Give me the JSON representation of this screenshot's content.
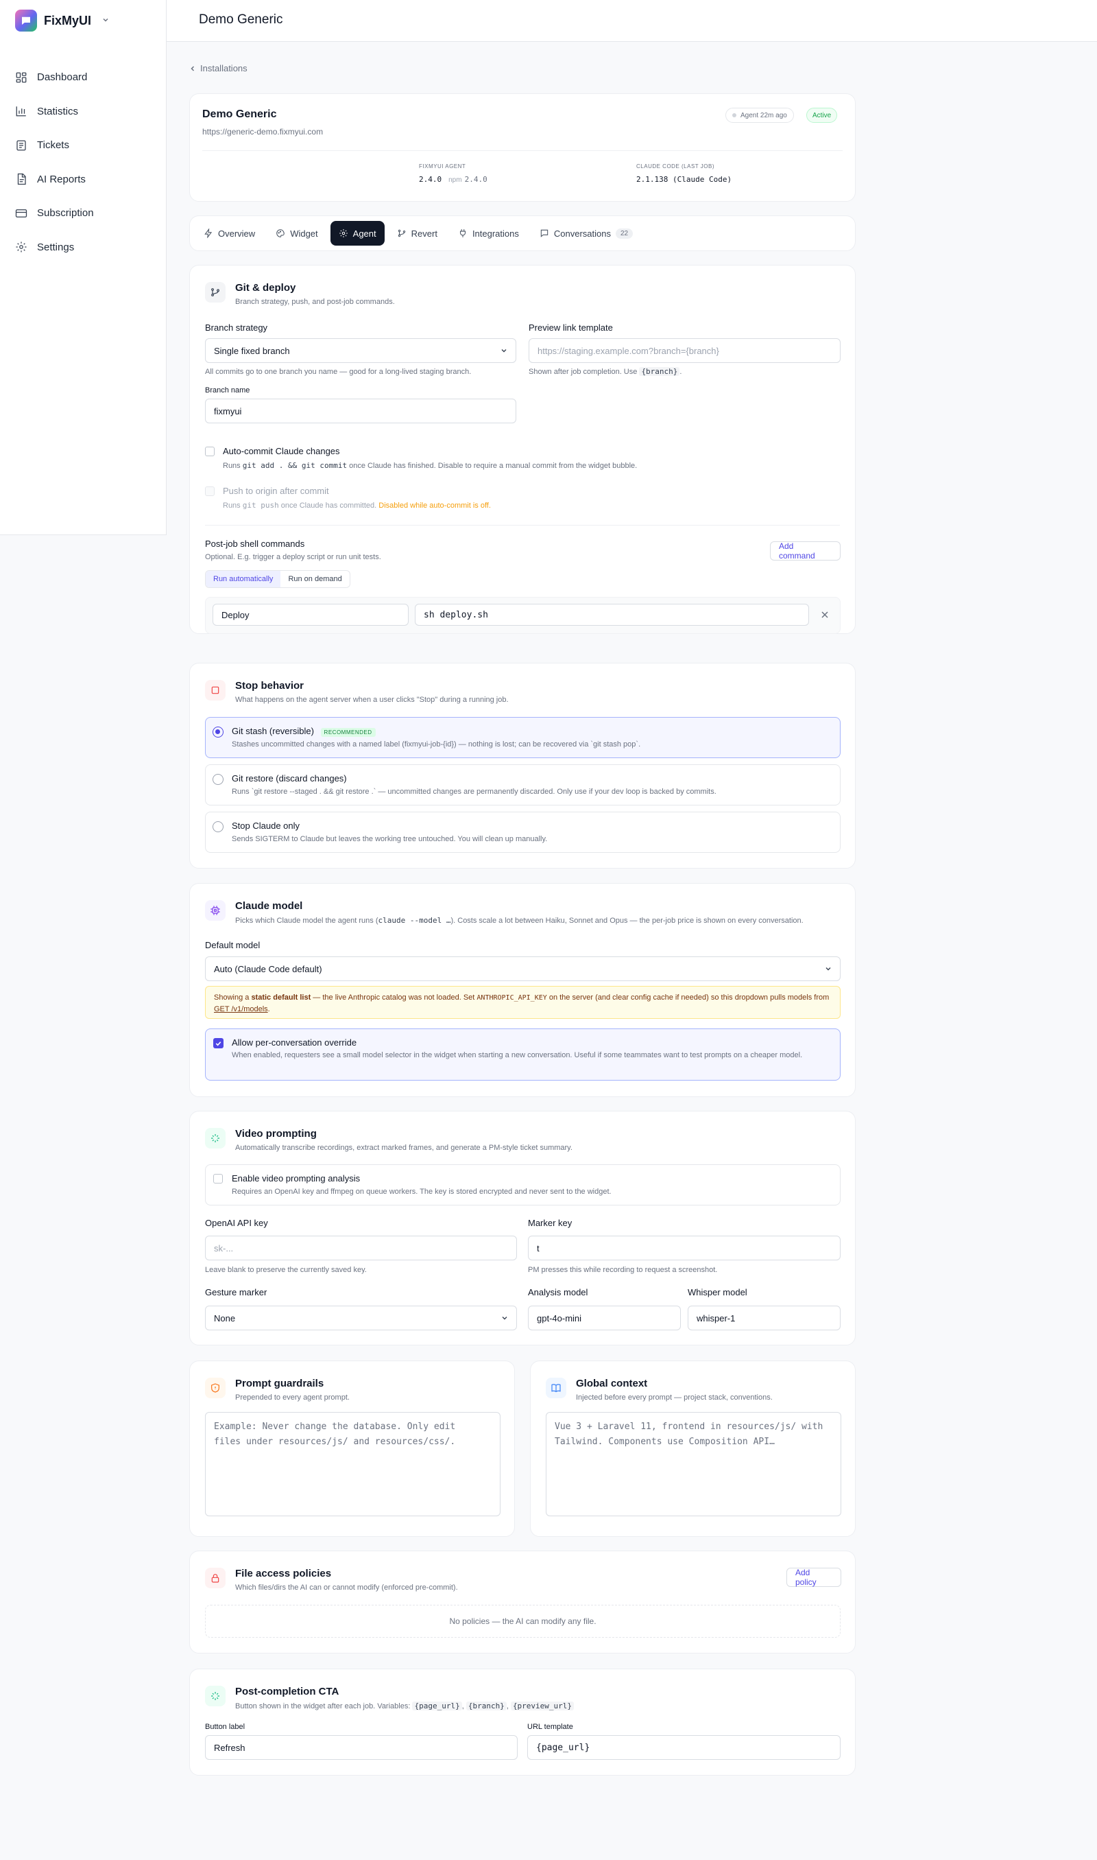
{
  "brand": {
    "name": "FixMyUI"
  },
  "sidebar": {
    "items": [
      {
        "label": "Dashboard"
      },
      {
        "label": "Statistics"
      },
      {
        "label": "Tickets"
      },
      {
        "label": "AI Reports"
      },
      {
        "label": "Subscription"
      },
      {
        "label": "Settings"
      }
    ]
  },
  "header": {
    "title": "Demo Generic"
  },
  "breadcrumb": {
    "back_label": "Installations"
  },
  "install": {
    "name": "Demo Generic",
    "url": "https://generic-demo.fixmyui.com",
    "agent_status": "Agent 22m ago",
    "badge": "Active",
    "agent_label": "FIXMYUI AGENT",
    "agent_version": "2.4.0",
    "npm_prefix": "npm",
    "npm_version": "2.4.0",
    "claude_label": "CLAUDE CODE (LAST JOB)",
    "claude_version": "2.1.138 (Claude Code)"
  },
  "tabs": [
    {
      "label": "Overview",
      "icon": "bolt-icon"
    },
    {
      "label": "Widget",
      "icon": "palette-icon"
    },
    {
      "label": "Agent",
      "icon": "gear-icon"
    },
    {
      "label": "Revert",
      "icon": "git-branch-icon"
    },
    {
      "label": "Integrations",
      "icon": "plug-icon"
    },
    {
      "label": "Conversations",
      "icon": "chat-icon",
      "count": "22"
    }
  ],
  "git": {
    "title": "Git & deploy",
    "subtitle": "Branch strategy, push, and post-job commands.",
    "branch_strategy_label": "Branch strategy",
    "branch_strategy_value": "Single fixed branch",
    "branch_strategy_help": "All commits go to one branch you name — good for a long-lived staging branch.",
    "preview_label": "Preview link template",
    "preview_placeholder": "https://staging.example.com?branch={branch}",
    "preview_help_pre": "Shown after job completion. Use",
    "preview_help_code": "{branch}",
    "preview_help_post": ".",
    "branch_name_label": "Branch name",
    "branch_name_value": "fixmyui",
    "autocommit_label": "Auto-commit Claude changes",
    "autocommit_help_pre": "Runs",
    "autocommit_help_code": "git add . && git commit",
    "autocommit_help_post": "once Claude has finished. Disable to require a manual commit from the widget bubble.",
    "push_label": "Push to origin after commit",
    "push_help_pre": "Runs",
    "push_help_code": "git push",
    "push_help_mid": "once Claude has committed.",
    "push_help_warn": "Disabled while auto-commit is off.",
    "postjob_title": "Post-job shell commands",
    "postjob_sub": "Optional. E.g. trigger a deploy script or run unit tests.",
    "add_command": "Add command",
    "seg_auto": "Run automatically",
    "seg_demand": "Run on demand",
    "cmd_name": "Deploy",
    "cmd_value": "sh deploy.sh"
  },
  "stop": {
    "title": "Stop behavior",
    "subtitle": "What happens on the agent server when a user clicks \"Stop\" during a running job.",
    "options": [
      {
        "title": "Git stash (reversible)",
        "badge": "RECOMMENDED",
        "desc": "Stashes uncommitted changes with a named label (fixmyui-job-{id}) — nothing is lost; can be recovered via `git stash pop`."
      },
      {
        "title": "Git restore (discard changes)",
        "desc": "Runs `git restore --staged . && git restore .` — uncommitted changes are permanently discarded. Only use if your dev loop is backed by commits."
      },
      {
        "title": "Stop Claude only",
        "desc": "Sends SIGTERM to Claude but leaves the working tree untouched. You will clean up manually."
      }
    ]
  },
  "model": {
    "title": "Claude model",
    "subtitle_pre": "Picks which Claude model the agent runs (",
    "subtitle_code": "claude --model …",
    "subtitle_post": "). Costs scale a lot between Haiku, Sonnet and Opus — the per-job price is shown on every conversation.",
    "default_label": "Default model",
    "default_value": "Auto (Claude Code default)",
    "warn_pre": "Showing a",
    "warn_bold": "static default list",
    "warn_mid": "— the live Anthropic catalog was not loaded. Set",
    "warn_code": "ANTHROPIC_API_KEY",
    "warn_post": "on the server (and clear config cache if needed) so this dropdown pulls models from",
    "warn_link": "GET /v1/models",
    "warn_end": ".",
    "override_label": "Allow per-conversation override",
    "override_desc": "When enabled, requesters see a small model selector in the widget when starting a new conversation. Useful if some teammates want to test prompts on a cheaper model."
  },
  "video": {
    "title": "Video prompting",
    "subtitle": "Automatically transcribe recordings, extract marked frames, and generate a PM-style ticket summary.",
    "enable_label": "Enable video prompting analysis",
    "enable_desc": "Requires an OpenAI key and ffmpeg on queue workers. The key is stored encrypted and never sent to the widget.",
    "openai_label": "OpenAI API key",
    "openai_placeholder": "sk-...",
    "openai_help": "Leave blank to preserve the currently saved key.",
    "marker_label": "Marker key",
    "marker_value": "t",
    "marker_help": "PM presses this while recording to request a screenshot.",
    "gesture_label": "Gesture marker",
    "gesture_value": "None",
    "analysis_label": "Analysis model",
    "analysis_value": "gpt-4o-mini",
    "whisper_label": "Whisper model",
    "whisper_value": "whisper-1"
  },
  "guardrails": {
    "title": "Prompt guardrails",
    "subtitle": "Prepended to every agent prompt.",
    "placeholder": "Example: Never change the database. Only edit\nfiles under resources/js/ and resources/css/."
  },
  "context": {
    "title": "Global context",
    "subtitle": "Injected before every prompt — project stack, conventions.",
    "placeholder": "Vue 3 + Laravel 11, frontend in resources/js/ with\nTailwind. Components use Composition API…"
  },
  "policies": {
    "title": "File access policies",
    "subtitle": "Which files/dirs the AI can or cannot modify (enforced pre-commit).",
    "add": "Add policy",
    "empty": "No policies — the AI can modify any file."
  },
  "cta": {
    "title": "Post-completion CTA",
    "subtitle": "Button shown in the widget after each job. Variables:",
    "vars": [
      "{page_url}",
      "{branch}",
      "{preview_url}"
    ],
    "button_label": "Button label",
    "button_value": "Refresh",
    "url_label": "URL template",
    "url_value": "{page_url}"
  },
  "colors": {
    "accent": "#4f46e5",
    "active_tab": "#111827",
    "success": "#16a34a",
    "warning_bg": "#fefce8"
  }
}
